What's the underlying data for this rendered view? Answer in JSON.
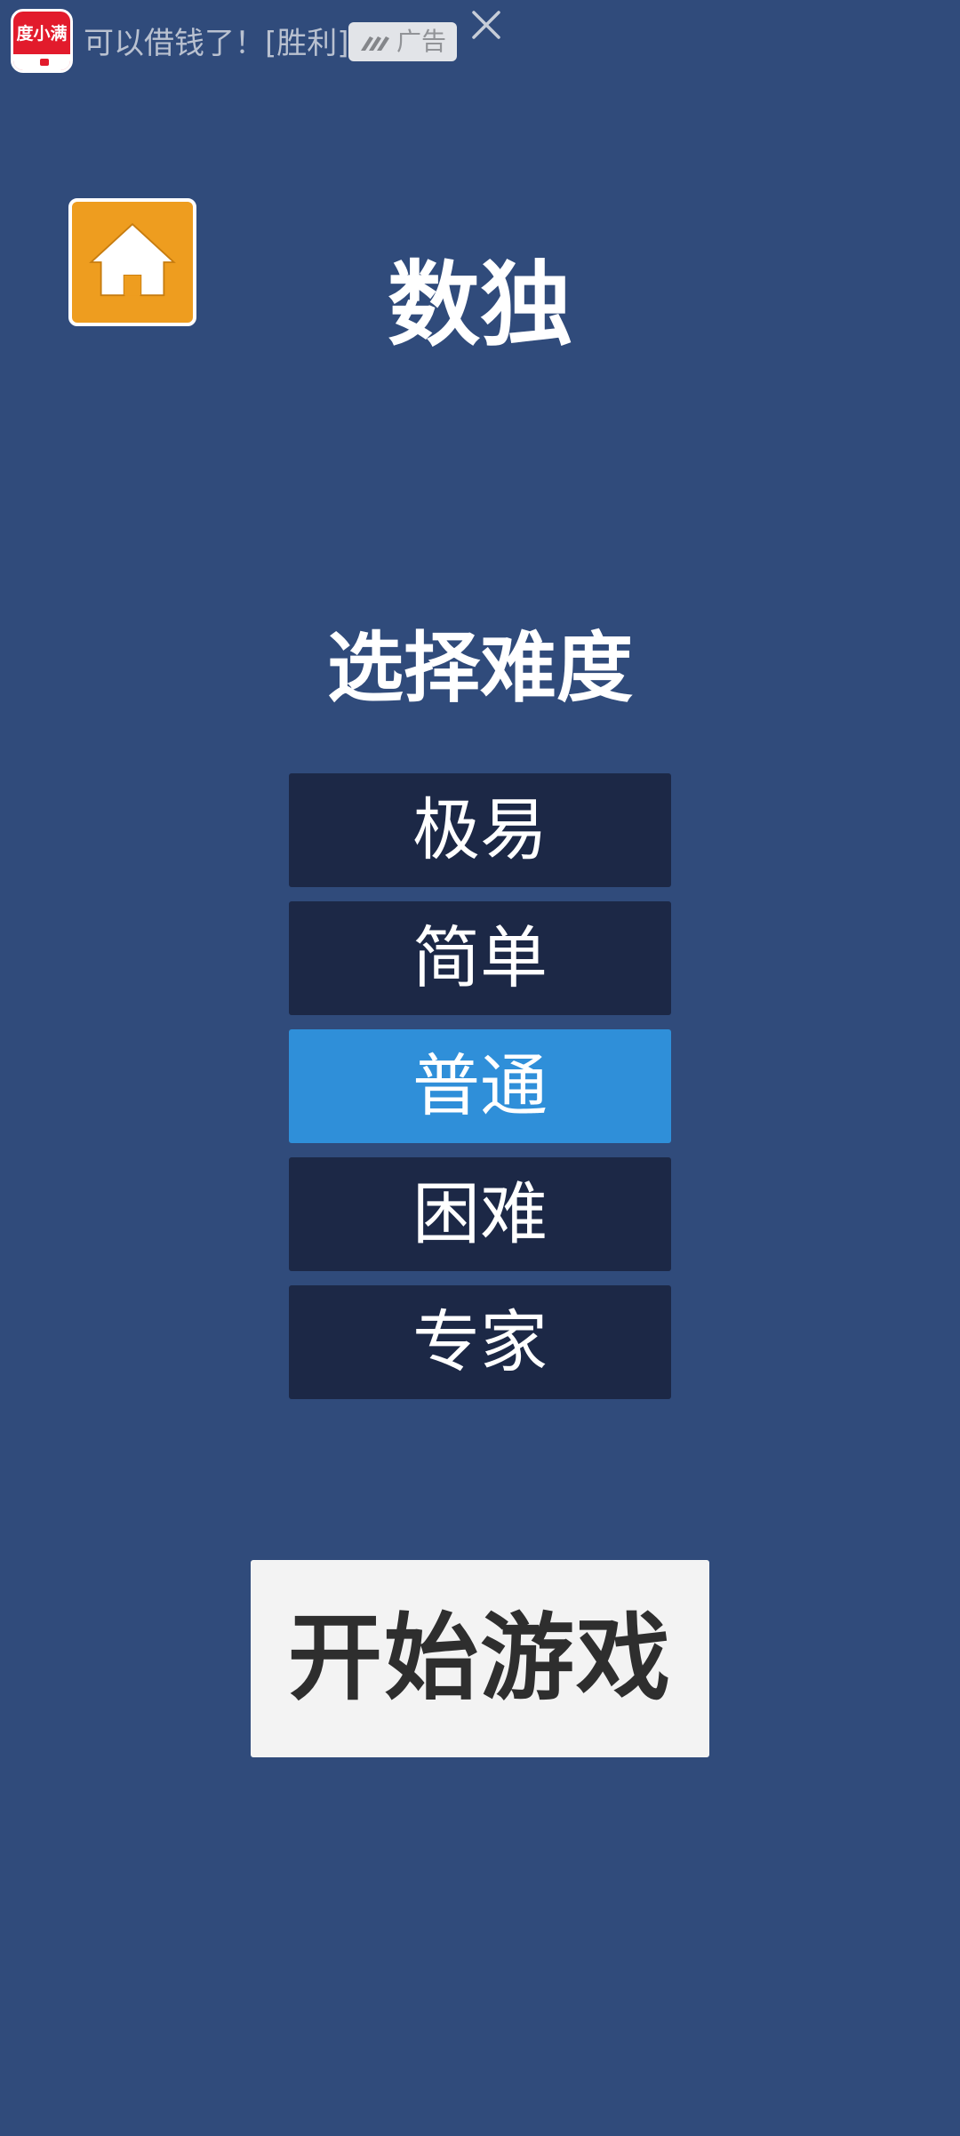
{
  "ad": {
    "app_icon_text": "度小满",
    "text": "可以借钱了！[胜利]",
    "badge_label": "广告",
    "close_icon": "close-icon"
  },
  "home_button": {
    "icon": "home-icon"
  },
  "title": "数独",
  "difficulty": {
    "heading": "选择难度",
    "options": [
      {
        "label": "极易",
        "selected": false
      },
      {
        "label": "简单",
        "selected": false
      },
      {
        "label": "普通",
        "selected": true
      },
      {
        "label": "困难",
        "selected": false
      },
      {
        "label": "专家",
        "selected": false
      }
    ]
  },
  "start_button": {
    "label": "开始游戏"
  },
  "colors": {
    "background": "#304b7b",
    "option_default": "#1c2846",
    "option_selected": "#2f8fd9",
    "home_button": "#ee9d1f",
    "start_button": "#f3f3f3"
  }
}
